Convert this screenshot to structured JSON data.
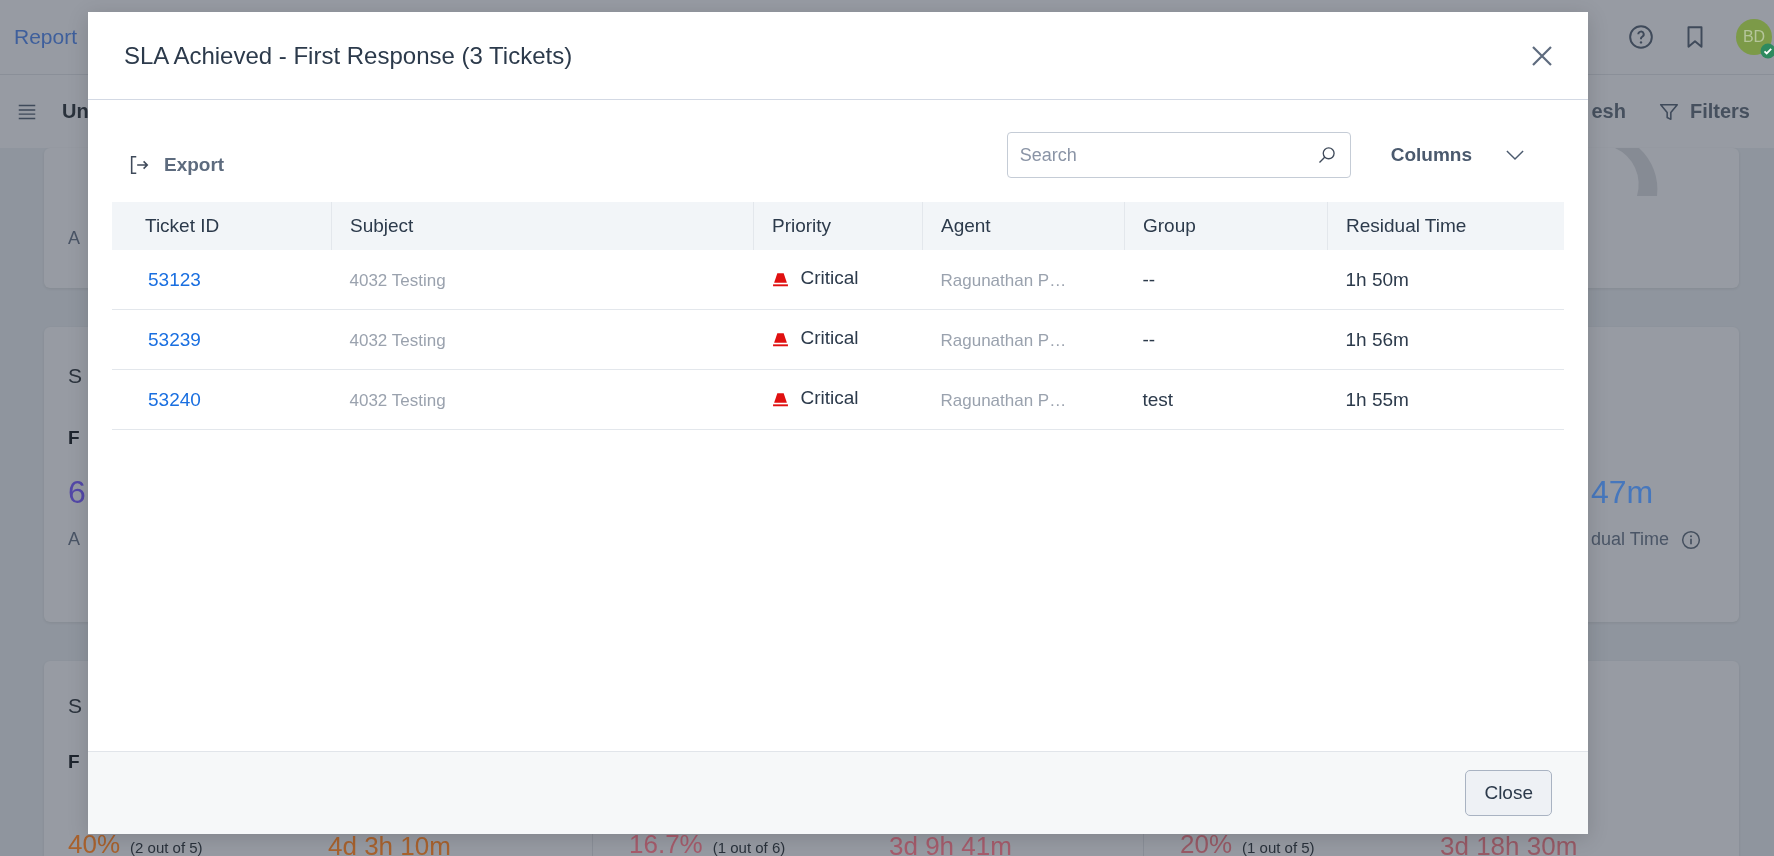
{
  "background": {
    "app_title": "Report",
    "user_initials": "BD",
    "report_title": "Un",
    "refresh_label": "esh",
    "filters_label": "Filters",
    "card_1": {
      "label": "A"
    },
    "card_2": {
      "title": "S",
      "subtitle": "F",
      "left_value": "6",
      "left_label": "A",
      "right_value": "47m",
      "right_label": "dual Time"
    },
    "card_3": {
      "title": "S",
      "subtitle": "F",
      "stats": [
        {
          "value": "40%",
          "detail": "(2 out of 5)",
          "time": "4d 3h 10m",
          "color": "#a8622e"
        },
        {
          "value": "16.7%",
          "detail": "(1 out of 6)",
          "time": "3d 9h 41m",
          "color": "#a65c6c"
        },
        {
          "value": "20%",
          "detail": "(1 out of 5)",
          "time": "3d 18h 30m",
          "color": "#985a66"
        }
      ]
    }
  },
  "dialog": {
    "title": "SLA Achieved - First Response (3 Tickets)",
    "export_label": "Export",
    "search": {
      "placeholder": "Search"
    },
    "columns_label": "Columns",
    "table": {
      "columns": [
        "Ticket ID",
        "Subject",
        "Priority",
        "Agent",
        "Group",
        "Residual Time"
      ],
      "rows": [
        {
          "ticket_id": "53123",
          "subject": "4032 Testing",
          "priority": {
            "kind": "critical",
            "label": "Critical"
          },
          "agent": "Ragunathan P…",
          "group": "--",
          "residual_time": "1h 50m"
        },
        {
          "ticket_id": "53239",
          "subject": "4032 Testing",
          "priority": {
            "kind": "critical",
            "label": "Critical"
          },
          "agent": "Ragunathan P…",
          "group": "--",
          "residual_time": "1h 56m"
        },
        {
          "ticket_id": "53240",
          "subject": "4032 Testing",
          "priority": {
            "kind": "critical",
            "label": "Critical"
          },
          "agent": "Ragunathan P…",
          "group": "test",
          "residual_time": "1h 55m"
        }
      ]
    },
    "close_label": "Close"
  }
}
